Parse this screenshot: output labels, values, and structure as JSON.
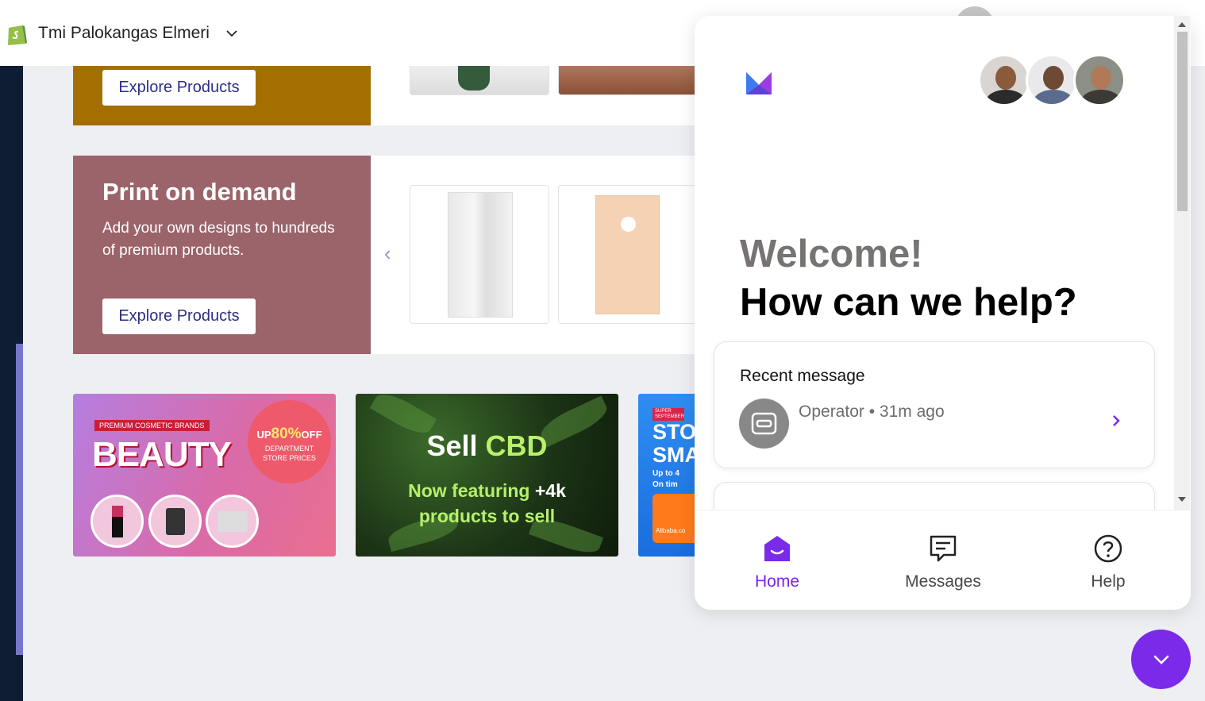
{
  "header": {
    "store_name": "Tmi Palokangas Elmeri"
  },
  "promos": [
    {
      "button_label": "Explore Products",
      "color": "#a56e00"
    },
    {
      "title": "Print on demand",
      "description": "Add your own designs to hundreds of premium products.",
      "button_label": "Explore Products",
      "color": "#9b646a"
    }
  ],
  "banners": {
    "beauty": {
      "tag": "PREMIUM COSMETIC BRANDS",
      "headline": "BEAUTY",
      "up_prefix": "UP",
      "percent": "80%",
      "off": "OFF",
      "department": "DEPARTMENT",
      "store_prices": "STORE PRICES"
    },
    "cbd": {
      "sell": "Sell",
      "cbd": "CBD",
      "line1_prefix": "Now featuring",
      "line1_count": "+4k",
      "line2": "products to sell"
    },
    "alibaba": {
      "tag_line1": "SUPER",
      "tag_line2": "SEPTEMBER",
      "line1": "STO",
      "line2": "SMA",
      "sub1": "Up to 4",
      "sub2": "On tim",
      "logo_text": "Alibaba.co"
    }
  },
  "widget": {
    "welcome": "Welcome!",
    "how_can_we_help": "How can we help?",
    "recent_message": {
      "title": "Recent message",
      "sender": "Operator",
      "separator": "•",
      "time_ago": "31m ago"
    },
    "nav": [
      {
        "label": "Home",
        "icon": "home-icon",
        "active": true
      },
      {
        "label": "Messages",
        "icon": "messages-icon",
        "active": false
      },
      {
        "label": "Help",
        "icon": "help-icon",
        "active": false
      }
    ],
    "accent_color": "#7b2ae9"
  }
}
